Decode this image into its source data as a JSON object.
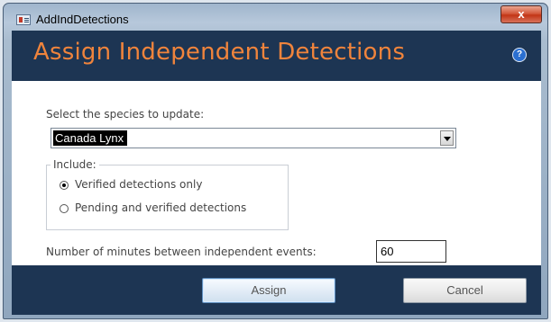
{
  "window": {
    "title": "AddIndDetections",
    "close_glyph": "x"
  },
  "header": {
    "title": "Assign Independent Detections",
    "help_glyph": "?"
  },
  "species": {
    "label": "Select the species to update:",
    "selected": "Canada Lynx"
  },
  "include": {
    "legend": "Include:",
    "options": [
      {
        "label": "Verified detections only",
        "checked": true
      },
      {
        "label": "Pending and verified detections",
        "checked": false
      }
    ]
  },
  "minutes": {
    "label": "Number of minutes between independent events:",
    "value": "60"
  },
  "buttons": {
    "assign": "Assign",
    "cancel": "Cancel"
  },
  "colors": {
    "title_accent": "#f0843c",
    "panel_bg": "#1d3553"
  },
  "icons": {
    "app": "form-icon",
    "help": "help-icon",
    "close": "close-icon",
    "dropdown": "chevron-down-icon"
  }
}
